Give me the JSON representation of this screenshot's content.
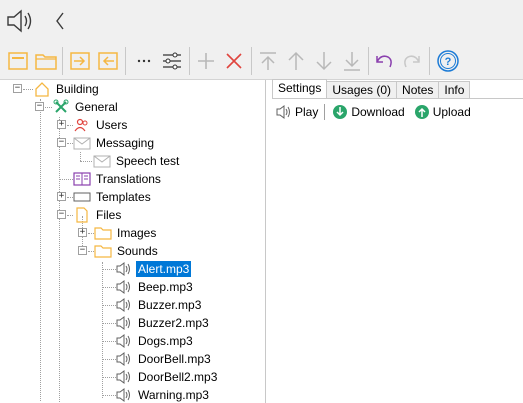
{
  "toolbar": {
    "speaker": "speaker-icon",
    "back": "back-arrow-icon"
  },
  "tree": {
    "root": "Building",
    "general": "General",
    "users": "Users",
    "messaging": "Messaging",
    "speech_test": "Speech test",
    "translations": "Translations",
    "templates": "Templates",
    "files": "Files",
    "images": "Images",
    "sounds": "Sounds",
    "sound_files": [
      "Alert.mp3",
      "Beep.mp3",
      "Buzzer.mp3",
      "Buzzer2.mp3",
      "Dogs.mp3",
      "DoorBell.mp3",
      "DoorBell2.mp3",
      "Warning.mp3"
    ],
    "selected": "Alert.mp3"
  },
  "tabs": [
    "Settings",
    "Usages (0)",
    "Notes",
    "Info"
  ],
  "active_tab": "Settings",
  "actions": {
    "play": "Play",
    "download": "Download",
    "upload": "Upload"
  },
  "colors": {
    "accent": "#0078d7",
    "folder": "#f5b742",
    "red": "#e0443e",
    "purple": "#8a3fae",
    "green": "#2aa56a",
    "blue": "#1c7bd6"
  }
}
